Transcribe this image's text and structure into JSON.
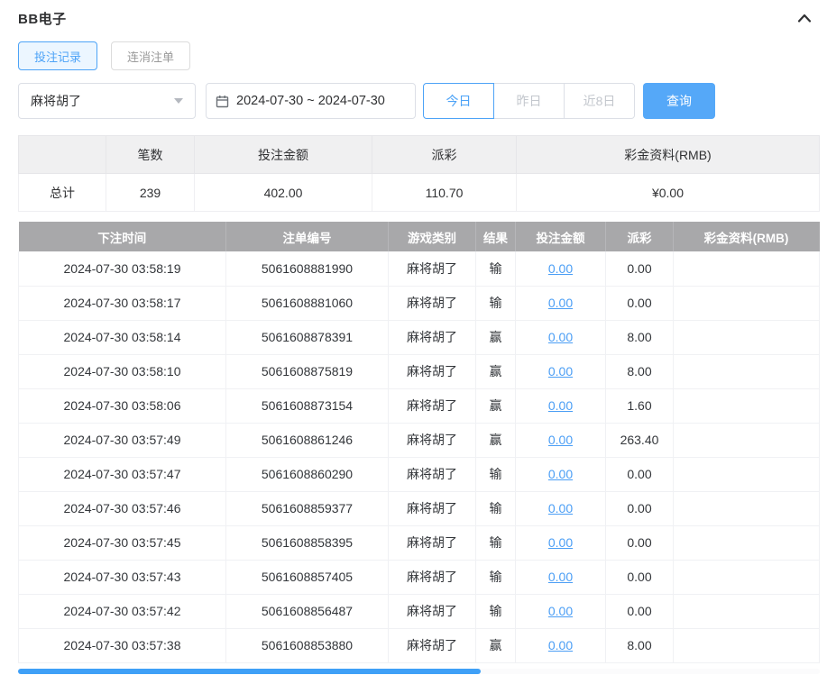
{
  "header": {
    "title": "BB电子"
  },
  "tabs": {
    "bet_records": "投注记录",
    "cancelled_orders": "连消注单"
  },
  "filters": {
    "game_select_value": "麻将胡了",
    "date_range_value": "2024-07-30 ~ 2024-07-30",
    "quick": {
      "today": "今日",
      "yesterday": "昨日",
      "last8": "近8日"
    },
    "search_label": "查询"
  },
  "summary": {
    "headers": [
      "",
      "笔数",
      "投注金额",
      "派彩",
      "彩金资料(RMB)"
    ],
    "total": {
      "label": "总计",
      "count": "239",
      "bet": "402.00",
      "payout": "110.70",
      "bonus": "¥0.00"
    }
  },
  "table": {
    "headers": [
      "下注时间",
      "注单编号",
      "游戏类别",
      "结果",
      "投注金额",
      "派彩",
      "彩金资料(RMB)"
    ],
    "rows": [
      {
        "time": "2024-07-30 03:58:19",
        "order_id": "5061608881990",
        "game": "麻将胡了",
        "result": "输",
        "bet": "0.00",
        "payout": "0.00",
        "bonus": ""
      },
      {
        "time": "2024-07-30 03:58:17",
        "order_id": "5061608881060",
        "game": "麻将胡了",
        "result": "输",
        "bet": "0.00",
        "payout": "0.00",
        "bonus": ""
      },
      {
        "time": "2024-07-30 03:58:14",
        "order_id": "5061608878391",
        "game": "麻将胡了",
        "result": "赢",
        "bet": "0.00",
        "payout": "8.00",
        "bonus": ""
      },
      {
        "time": "2024-07-30 03:58:10",
        "order_id": "5061608875819",
        "game": "麻将胡了",
        "result": "赢",
        "bet": "0.00",
        "payout": "8.00",
        "bonus": ""
      },
      {
        "time": "2024-07-30 03:58:06",
        "order_id": "5061608873154",
        "game": "麻将胡了",
        "result": "赢",
        "bet": "0.00",
        "payout": "1.60",
        "bonus": ""
      },
      {
        "time": "2024-07-30 03:57:49",
        "order_id": "5061608861246",
        "game": "麻将胡了",
        "result": "赢",
        "bet": "0.00",
        "payout": "263.40",
        "bonus": ""
      },
      {
        "time": "2024-07-30 03:57:47",
        "order_id": "5061608860290",
        "game": "麻将胡了",
        "result": "输",
        "bet": "0.00",
        "payout": "0.00",
        "bonus": ""
      },
      {
        "time": "2024-07-30 03:57:46",
        "order_id": "5061608859377",
        "game": "麻将胡了",
        "result": "输",
        "bet": "0.00",
        "payout": "0.00",
        "bonus": ""
      },
      {
        "time": "2024-07-30 03:57:45",
        "order_id": "5061608858395",
        "game": "麻将胡了",
        "result": "输",
        "bet": "0.00",
        "payout": "0.00",
        "bonus": ""
      },
      {
        "time": "2024-07-30 03:57:43",
        "order_id": "5061608857405",
        "game": "麻将胡了",
        "result": "输",
        "bet": "0.00",
        "payout": "0.00",
        "bonus": ""
      },
      {
        "time": "2024-07-30 03:57:42",
        "order_id": "5061608856487",
        "game": "麻将胡了",
        "result": "输",
        "bet": "0.00",
        "payout": "0.00",
        "bonus": ""
      },
      {
        "time": "2024-07-30 03:57:38",
        "order_id": "5061608853880",
        "game": "麻将胡了",
        "result": "赢",
        "bet": "0.00",
        "payout": "8.00",
        "bonus": ""
      }
    ]
  },
  "colors": {
    "accent_blue": "#4da3f7",
    "search_button_blue": "#55a8f8",
    "link_blue": "#4b9ef5",
    "records_header_gray": "#a8a8aa",
    "summary_header_gray": "#f0f0f1",
    "scrollbar_blue": "#3fa0f7"
  }
}
